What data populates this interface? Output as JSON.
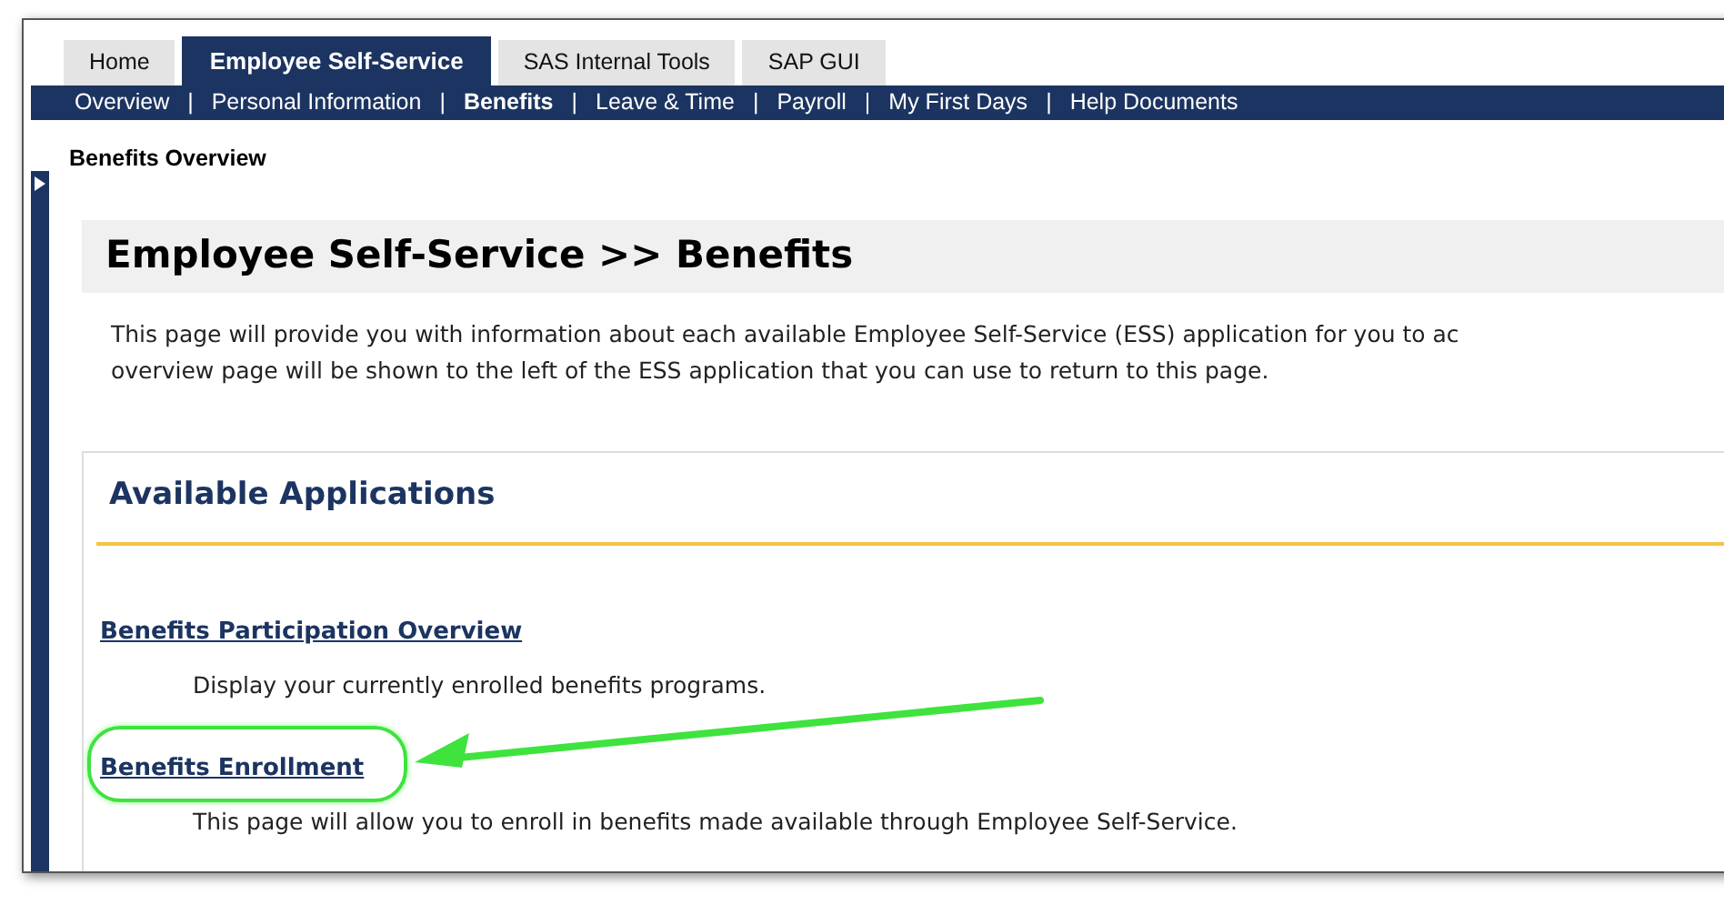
{
  "tabs": [
    {
      "label": "Home",
      "selected": false
    },
    {
      "label": "Employee Self-Service",
      "selected": true
    },
    {
      "label": "SAS Internal Tools",
      "selected": false
    },
    {
      "label": "SAP GUI",
      "selected": false
    }
  ],
  "subnav": [
    {
      "label": "Overview",
      "selected": false
    },
    {
      "label": "Personal Information",
      "selected": false
    },
    {
      "label": "Benefits",
      "selected": true
    },
    {
      "label": "Leave & Time",
      "selected": false
    },
    {
      "label": "Payroll",
      "selected": false
    },
    {
      "label": "My First Days",
      "selected": false
    },
    {
      "label": "Help Documents",
      "selected": false
    }
  ],
  "separator": "|",
  "breadcrumb": "Benefits Overview",
  "page_title": "Employee Self-Service >> Benefits",
  "intro_lines": [
    "This page will provide you with information about each available Employee Self-Service (ESS) application for you to ac",
    "overview page will be shown to the left of the ESS application that you can use to return to this page."
  ],
  "section_title": "Available Applications",
  "applications": [
    {
      "link": "Benefits Participation Overview",
      "description": "Display your currently enrolled benefits programs.",
      "highlighted": false
    },
    {
      "link": "Benefits Enrollment",
      "description": "This page will allow you to enroll in benefits made available through Employee Self-Service.",
      "highlighted": true
    }
  ]
}
